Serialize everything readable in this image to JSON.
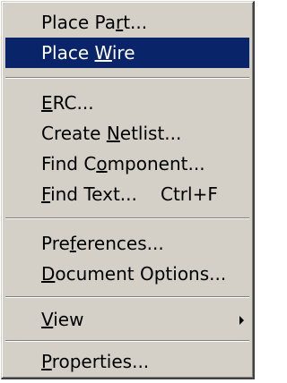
{
  "menu": {
    "items": [
      {
        "pre": "Place Pa",
        "key": "r",
        "post": "t..."
      },
      {
        "pre": "Place ",
        "key": "W",
        "post": "ire"
      },
      {
        "pre": "",
        "key": "E",
        "post": "RC..."
      },
      {
        "pre": "Create ",
        "key": "N",
        "post": "etlist..."
      },
      {
        "pre": "Find C",
        "key": "o",
        "post": "mponent..."
      },
      {
        "pre": "",
        "key": "F",
        "post": "ind Text...",
        "shortcut": "Ctrl+F"
      },
      {
        "pre": "Pre",
        "key": "f",
        "post": "erences..."
      },
      {
        "pre": "",
        "key": "D",
        "post": "ocument Options..."
      },
      {
        "pre": "",
        "key": "V",
        "post": "iew"
      },
      {
        "pre": "",
        "key": "P",
        "post": "roperties..."
      }
    ],
    "selected_index": 1,
    "colors": {
      "background": "#d4d0c8",
      "highlight": "#0a246a",
      "highlight_text": "#ffffff"
    }
  }
}
